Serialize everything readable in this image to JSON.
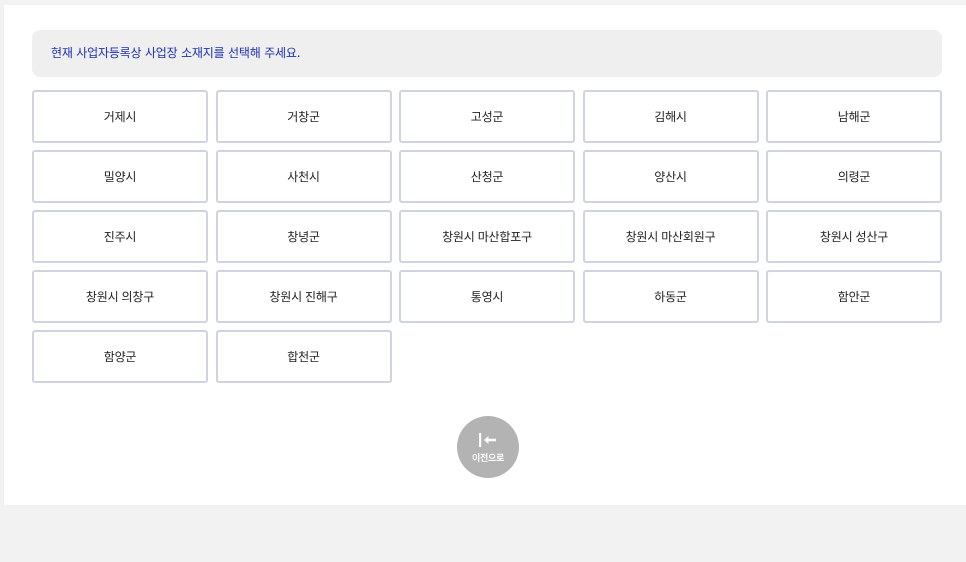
{
  "notice": {
    "text": "현재 사업자등록상 사업장 소재지를 선택해 주세요."
  },
  "regions": [
    "거제시",
    "거창군",
    "고성군",
    "김해시",
    "남해군",
    "밀양시",
    "사천시",
    "산청군",
    "양산시",
    "의령군",
    "진주시",
    "창녕군",
    "창원시 마산합포구",
    "창원시 마산회원구",
    "창원시 성산구",
    "창원시 의창구",
    "창원시 진해구",
    "통영시",
    "하동군",
    "함안군",
    "함양군",
    "합천군"
  ],
  "back_button": {
    "label": "이전으로",
    "icon": "back-arrow-icon"
  },
  "colors": {
    "notice_text": "#1e2fb5",
    "notice_bg": "#efefef",
    "button_border": "#d0d4e0",
    "back_button_bg": "#b3b3b3"
  }
}
